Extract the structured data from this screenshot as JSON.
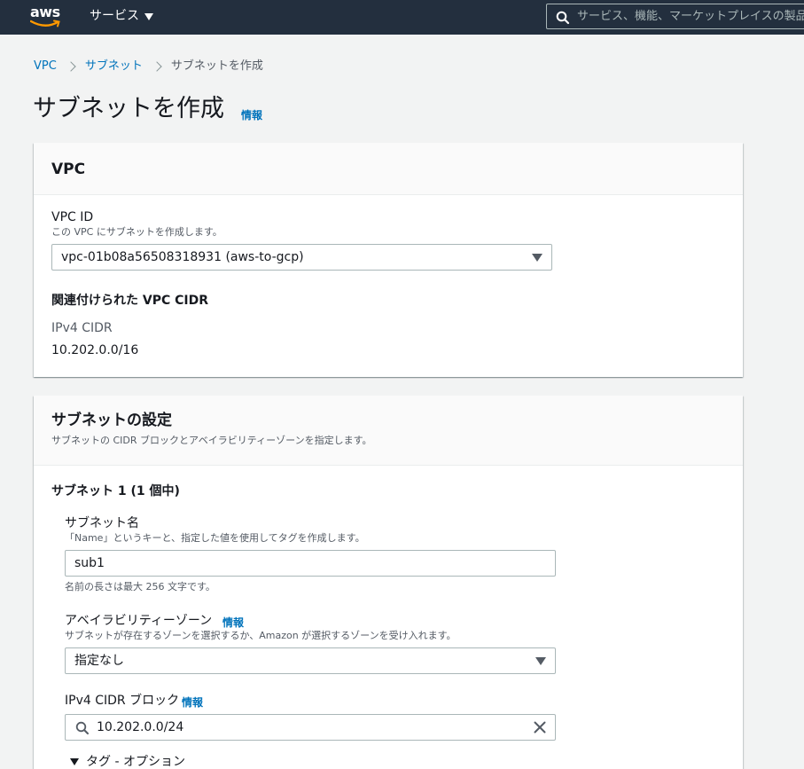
{
  "topbar": {
    "logo_text": "aws",
    "services_label": "サービス",
    "search_placeholder": "サービス、機能、マーケットプレイスの製品、ドキュメントを検索"
  },
  "breadcrumb": {
    "items": [
      "VPC",
      "サブネット",
      "サブネットを作成"
    ]
  },
  "page": {
    "title": "サブネットを作成",
    "info": "情報"
  },
  "vpc_panel": {
    "heading": "VPC",
    "vpc_id_label": "VPC ID",
    "vpc_id_desc": "この VPC にサブネットを作成します。",
    "vpc_id_value": "vpc-01b08a56508318931 (aws-to-gcp)",
    "cidr_heading": "関連付けられた VPC CIDR",
    "ipv4_label": "IPv4 CIDR",
    "ipv4_value": "10.202.0.0/16"
  },
  "subnet_panel": {
    "heading": "サブネットの設定",
    "desc": "サブネットの CIDR ブロックとアベイラビリティーゾーンを指定します。",
    "subnet_heading": "サブネット 1 (1 個中)",
    "name_label": "サブネット名",
    "name_desc": "「Name」というキーと、指定した値を使用してタグを作成します。",
    "name_value": "sub1",
    "name_hint": "名前の長さは最大 256 文字です。",
    "az_label": "アベイラビリティーゾーン",
    "az_info": "情報",
    "az_desc": "サブネットが存在するゾーンを選択するか、Amazon が選択するゾーンを受け入れます。",
    "az_value": "指定なし",
    "cidr_label": "IPv4 CIDR ブロック",
    "cidr_info": "情報",
    "cidr_value": "10.202.0.0/24",
    "tags_label": "タグ - オプション"
  }
}
